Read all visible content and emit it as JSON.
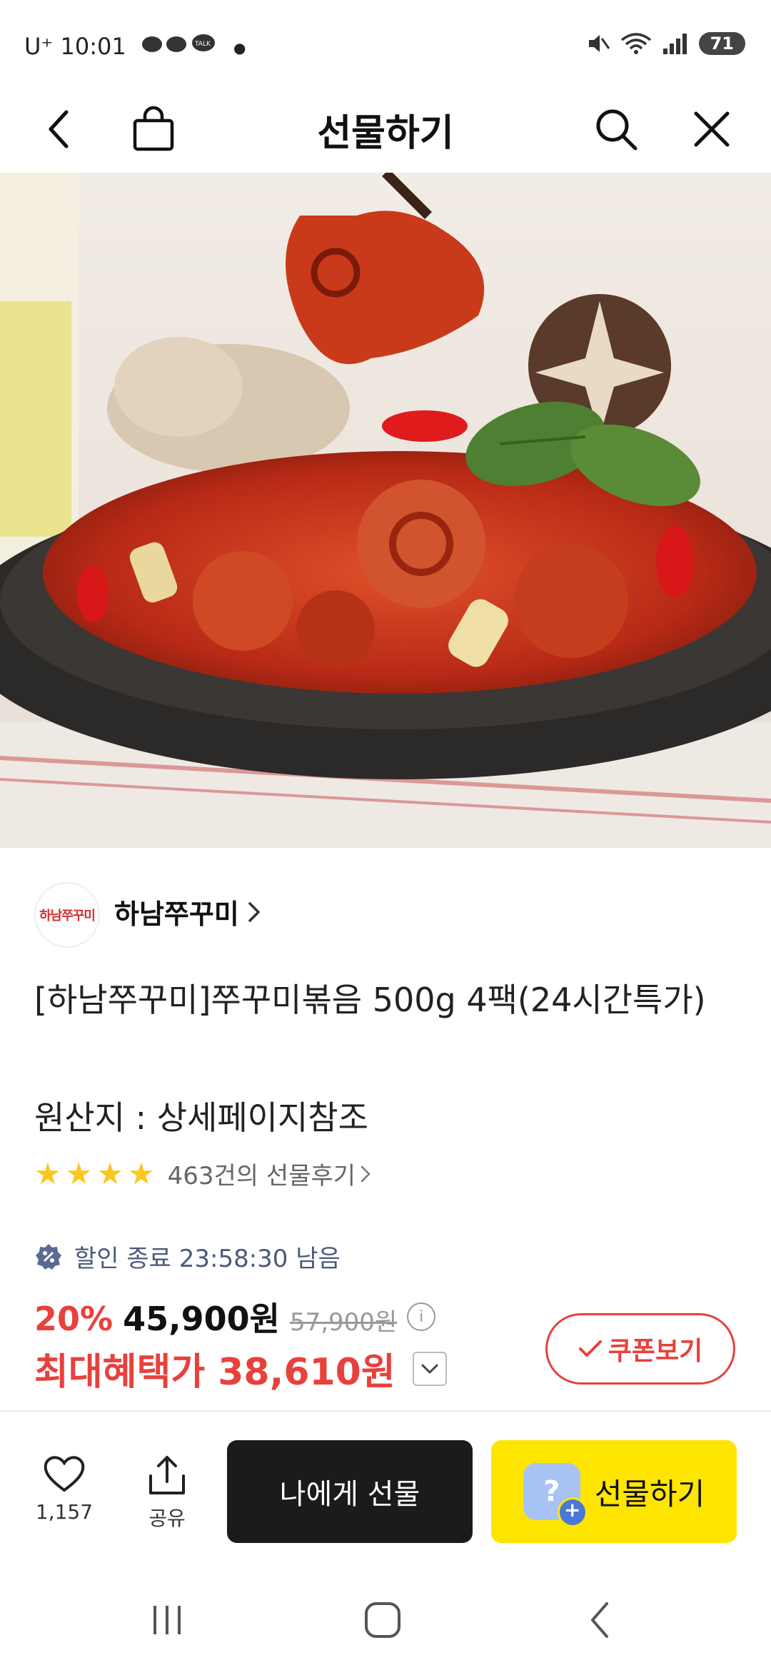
{
  "status_bar": {
    "time": "10:01",
    "carrier": "U⁺",
    "battery": "71",
    "signal": "5"
  },
  "header": {
    "title": "선물하기",
    "back_icon": "chevron-left-icon",
    "bag_icon": "shopping-bag-icon",
    "search_icon": "search-icon",
    "close_icon": "close-icon"
  },
  "product": {
    "seller_logo_text": "하남쭈꾸미",
    "seller_name": "하남쭈꾸미",
    "title": "[하남쭈꾸미]쭈꾸미볶음 500g 4팩(24시간특가)",
    "origin": "원산지 : 상세페이지참조",
    "rating_stars": 4,
    "review_link": "463건의 선물후기"
  },
  "pricing": {
    "deal_text": "할인 종료 23:58:30 남음",
    "discount": "20%",
    "price": "45,900원",
    "original_price": "57,900원",
    "best_label": "최대혜택가",
    "best_price": "38,610원",
    "coupon_button": "쿠폰보기"
  },
  "actions": {
    "like_count": "1,157",
    "share_label": "공유",
    "gift_me_label": "나에게 선물",
    "gift_label": "선물하기"
  },
  "colors": {
    "accent_red": "#e8413c",
    "kakao_yellow": "#fee500",
    "dark_button": "#1b1b1b"
  }
}
